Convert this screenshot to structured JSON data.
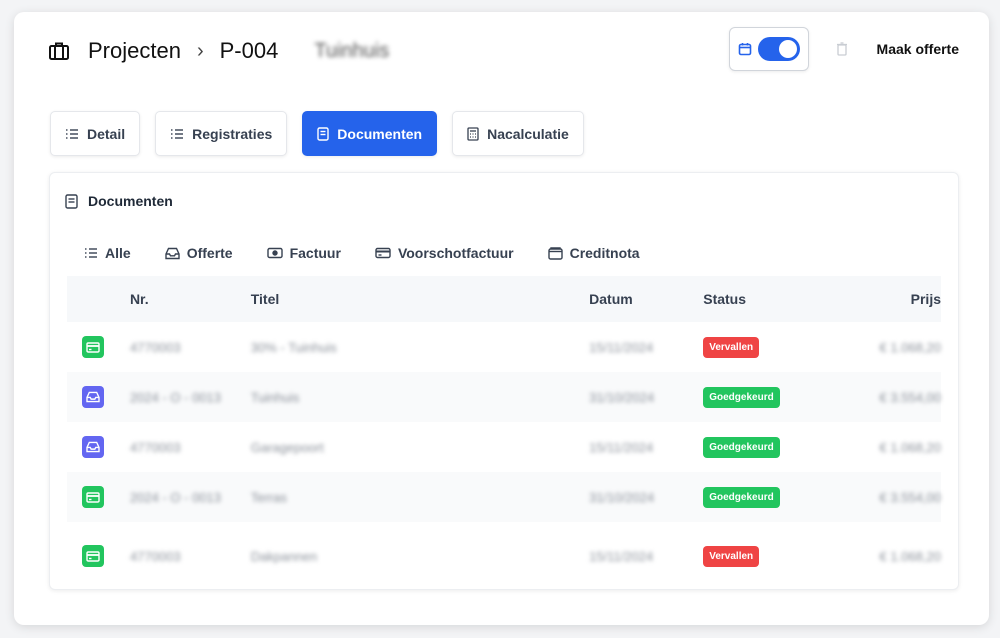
{
  "breadcrumb": {
    "section": "Projecten",
    "separator": "›",
    "project_id": "P-004",
    "project_name": "Tuinhuis"
  },
  "header": {
    "offerte_label": "Maak offerte"
  },
  "tabs": [
    {
      "label": "Detail",
      "icon": "list-icon",
      "active": false
    },
    {
      "label": "Registraties",
      "icon": "list-icon",
      "active": false
    },
    {
      "label": "Documenten",
      "icon": "document-icon",
      "active": true
    },
    {
      "label": "Nacalculatie",
      "icon": "calculator-icon",
      "active": false
    }
  ],
  "panel": {
    "title": "Documenten",
    "filters": [
      {
        "label": "Alle",
        "icon": "list-icon"
      },
      {
        "label": "Offerte",
        "icon": "inbox-icon"
      },
      {
        "label": "Factuur",
        "icon": "banknote-icon"
      },
      {
        "label": "Voorschotfactuur",
        "icon": "credit-card-icon"
      },
      {
        "label": "Creditnota",
        "icon": "wallet-icon"
      }
    ]
  },
  "table": {
    "headers": {
      "nr": "Nr.",
      "titel": "Titel",
      "datum": "Datum",
      "status": "Status",
      "prijs": "Prijs"
    },
    "rows": [
      {
        "type": "factuur",
        "nr": "4770003",
        "titel": "30% - Tuinhuis",
        "datum": "15/11/2024",
        "status": "Vervallen",
        "prijs": "€ 1.068,20"
      },
      {
        "type": "offerte",
        "nr": "2024 - O - 0013",
        "titel": "Tuinhuis",
        "datum": "31/10/2024",
        "status": "Goedgekeurd",
        "prijs": "€ 3.554,00"
      },
      {
        "type": "offerte",
        "nr": "4770003",
        "titel": "Garagepoort",
        "datum": "15/11/2024",
        "status": "Goedgekeurd",
        "prijs": "€ 1.068,20"
      },
      {
        "type": "factuur",
        "nr": "2024 - O - 0013",
        "titel": "Terras",
        "datum": "31/10/2024",
        "status": "Goedgekeurd",
        "prijs": "€ 3.554,00"
      },
      {
        "type": "factuur",
        "nr": "4770003",
        "titel": "Dakpannen",
        "datum": "15/11/2024",
        "status": "Vervallen",
        "prijs": "€ 1.068,20"
      }
    ]
  },
  "colors": {
    "accent": "#2563eb",
    "status_red": "#ef4444",
    "status_green": "#22c55e",
    "offerte_purple": "#6366f1"
  }
}
